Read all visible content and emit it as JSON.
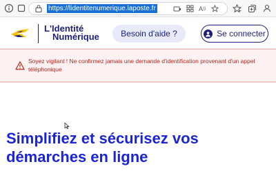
{
  "browser": {
    "url": "https://lidentitenumerique.laposte.fr",
    "icons": [
      "info-icon",
      "lock-icon",
      "device-icon",
      "apps-icon",
      "read-aloud-icon",
      "star-icon",
      "favorites-icon",
      "collections-icon",
      "profile-icon"
    ]
  },
  "header": {
    "logo_line1": "L'Identité",
    "logo_line2": "Numérique",
    "help_label": "Besoin d'aide ?",
    "login_label": "Se connecter"
  },
  "alert": {
    "message": "Soyez vigilant ! Ne confirmez jamais une demande d'identification provenant d'un appel téléphonique",
    "color": "#b3261e",
    "background": "#fdf1f1"
  },
  "hero": {
    "title_line1": "Simplifiez et sécurisez vos",
    "title_line2": "démarches en ligne"
  },
  "colors": {
    "brand_navy": "#1b1f7a",
    "brand_yellow": "#f5c400",
    "hero_blue": "#1b24d6"
  }
}
